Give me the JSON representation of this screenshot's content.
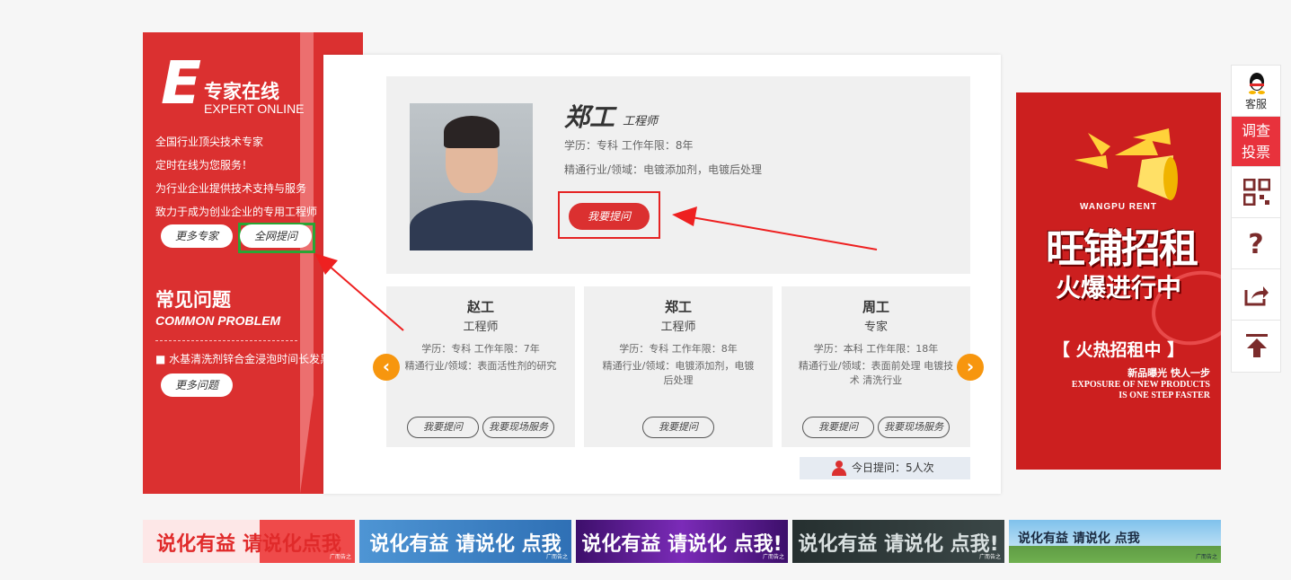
{
  "sidebar": {
    "letter": "E",
    "title": "专家在线",
    "subtitle": "EXPERT ONLINE",
    "intro_lines": [
      "全国行业顶尖技术专家",
      "定时在线为您服务！",
      "为行业企业提供技术支持与服务",
      "致力于成为创业企业的专用工程师"
    ],
    "more_experts_label": "更多专家",
    "ask_all_label": "全网提问",
    "faq_title": "常见问题",
    "faq_subtitle": "COMMON PROBLEM",
    "faq_items": [
      "水基清洗剂锌合金浸泡时间长发黑"
    ],
    "more_faq_label": "更多问题"
  },
  "featured": {
    "name": "郑工",
    "title": "工程师",
    "line1": "学历：专科   工作年限：8年",
    "line2": "精通行业/领域：电镀添加剂，电镀后处理",
    "ask_label": "我要提问"
  },
  "experts": [
    {
      "name": "赵工",
      "title": "工程师",
      "line1": "学历：专科   工作年限：7年",
      "line2": "精通行业/领域：表面活性剂的研究",
      "btn1": "我要提问",
      "btn2": "我要现场服务"
    },
    {
      "name": "郑工",
      "title": "工程师",
      "line1": "学历：专科   工作年限：8年",
      "line2": "精通行业/领域：电镀添加剂，电镀后处理",
      "btn1": "我要提问"
    },
    {
      "name": "周工",
      "title": "专家",
      "line1": "学历：本科   工作年限：18年",
      "line2": "精通行业/领域：表面前处理 电镀技术 清洗行业",
      "btn1": "我要提问",
      "btn2": "我要现场服务"
    }
  ],
  "carousel": {
    "prev_icon": "‹",
    "next_icon": "›"
  },
  "today": "今日提问：5人次",
  "ad": {
    "brand": "WANGPU RENT",
    "headline": "旺铺招租",
    "subline": "火爆进行中",
    "hot": "【 火热招租中 】",
    "tagline": "新品曝光 快人一步",
    "en1": "EXPOSURE OF NEW PRODUCTS",
    "en2": "IS ONE STEP FASTER"
  },
  "toolbar": {
    "service": "客服",
    "survey_line1": "调查",
    "survey_line2": "投票",
    "icons": [
      "qq-icon",
      "qr-code-icon",
      "question-icon",
      "share-icon",
      "back-to-top-icon"
    ]
  },
  "banners": [
    {
      "text": "说化有益 请说化点我",
      "small": "广而告之",
      "bg": "#fde0e0",
      "color": "#e02a2a"
    },
    {
      "text": "说化有益 请说化 点我",
      "small": "广而告之",
      "bg": "#3f86c7",
      "color": "#ffffff"
    },
    {
      "text": "说化有益 请说化 点我!",
      "small": "广而告之",
      "bg": "#5a1a8a",
      "color": "#ffffff"
    },
    {
      "text": "说化有益 请说化 点我!",
      "small": "广而告之",
      "bg": "#2f3b3b",
      "color": "#d9e0e0"
    },
    {
      "text": "说化有益 请说化 点我",
      "small": "广而告之",
      "bg": "#8ec6ea",
      "color": "#1a2a40"
    }
  ]
}
